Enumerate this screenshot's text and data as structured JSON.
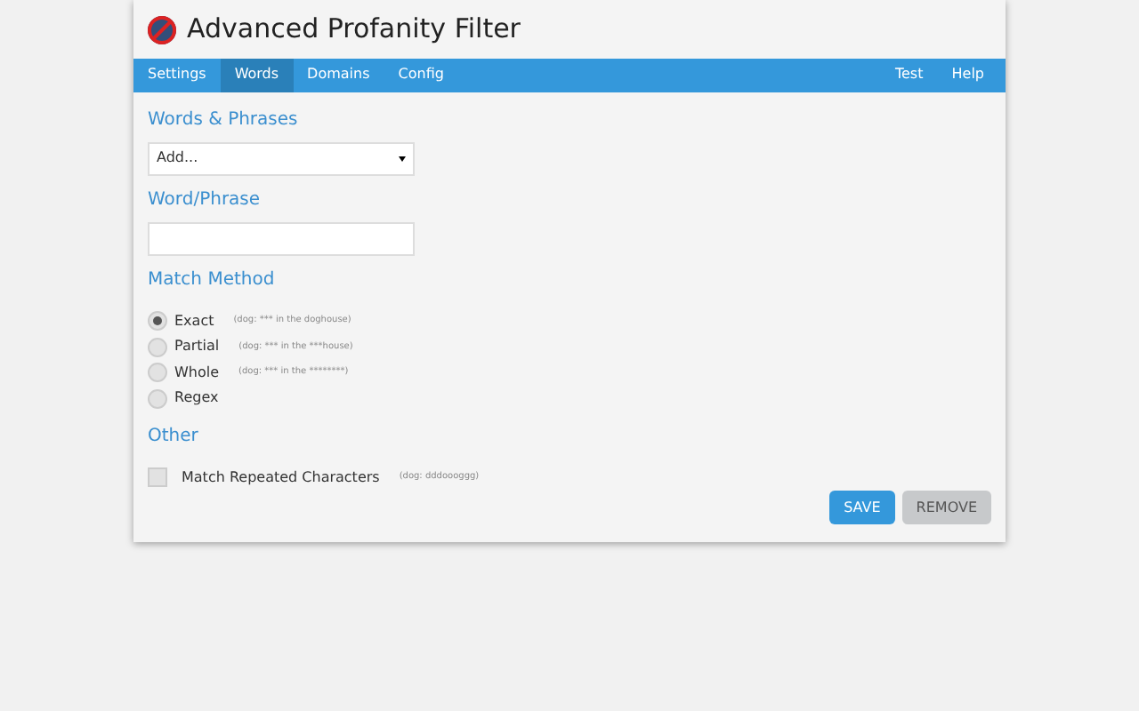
{
  "title": "Advanced Profanity Filter",
  "nav_left": [
    {
      "label": "Settings",
      "selected": false
    },
    {
      "label": "Words",
      "selected": true
    },
    {
      "label": "Domains",
      "selected": false
    },
    {
      "label": "Config",
      "selected": false
    }
  ],
  "nav_right": [
    {
      "label": "Test",
      "selected": false
    },
    {
      "label": "Help",
      "selected": false
    }
  ],
  "words_heading": "Words & Phrases",
  "words_select": {
    "value": "Add..."
  },
  "phrase_heading": "Word/Phrase",
  "method_heading": "Match Method",
  "methods": [
    {
      "label": "Exact",
      "hint": "(dog: *** in the doghouse)",
      "selected": true
    },
    {
      "label": "Partial",
      "hint": "(dog: *** in the ***house)",
      "selected": false
    },
    {
      "label": "Whole",
      "hint": "(dog: *** in the ********)",
      "selected": false
    },
    {
      "label": "Regex",
      "selected": false
    }
  ],
  "other_heading": "Other",
  "options": [
    {
      "label": "Match Repeated Characters",
      "hint": "(dog: dddoooggg)",
      "checked": false
    }
  ],
  "buttons": [
    {
      "label": "SAVE",
      "kind": "primary"
    },
    {
      "label": "REMOVE",
      "kind": "secondary"
    }
  ]
}
